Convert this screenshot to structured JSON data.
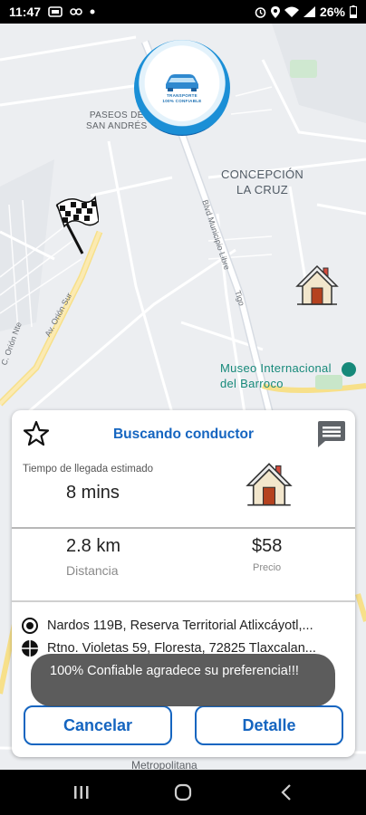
{
  "status_bar": {
    "time": "11:47",
    "battery": "26%"
  },
  "map": {
    "labels": {
      "paseos": "PASEOS DE\nSAN ANDRÉS",
      "concepcion": "CONCEPCIÓN\nLA CRUZ",
      "museo": "Museo Internacional\ndel Barroco",
      "metropolitana": "Metropolitana"
    },
    "road_labels": {
      "blvd": "Blvd Municipio Libre",
      "tigo": "Tigo",
      "orion_sur": "Av. Orión Sur",
      "orion_nte": "C. Orión Nte"
    },
    "logo_text": "TRANSPORTE\n100% CONFIABLE"
  },
  "card": {
    "title": "Buscando conductor",
    "eta_label": "Tiempo de llegada estimado",
    "eta_value": "8 mins",
    "distance_value": "2.8 km",
    "distance_label": "Distancia",
    "price_value": "$58",
    "price_label": "Precio",
    "origin": "Nardos 119B, Reserva Territorial Atlixcáyotl,...",
    "destination": "Rtno. Violetas 59, Floresta, 72825 Tlaxcalan...",
    "cancel_label": "Cancelar",
    "detail_label": "Detalle"
  },
  "toast": {
    "text": "100% Confiable  agradece su preferencia!!!"
  },
  "colors": {
    "accent": "#1565c0",
    "toast_bg": "#505050",
    "museum_teal": "#16897a"
  },
  "icons": {
    "star": "star-icon",
    "chat": "chat-icon",
    "house": "house-icon",
    "flag": "checkered-flag-icon",
    "origin": "target-icon",
    "destination": "crosshair-icon"
  }
}
